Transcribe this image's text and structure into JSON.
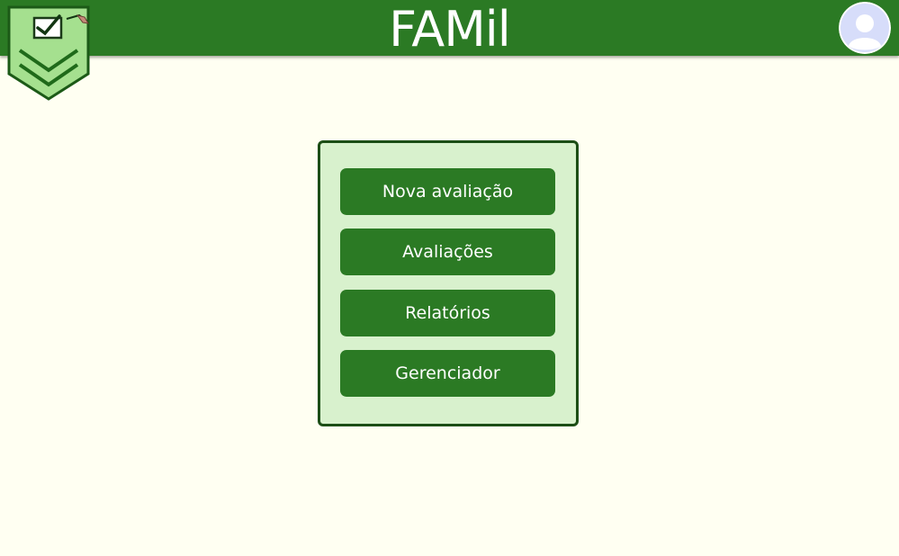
{
  "header": {
    "title": "FAMil",
    "logo_icon": "checklist-shield-logo-icon",
    "avatar_icon": "user-avatar-icon"
  },
  "menu": {
    "items": [
      {
        "label": "Nova avaliação"
      },
      {
        "label": "Avaliações"
      },
      {
        "label": "Relatórios"
      },
      {
        "label": "Gerenciador"
      }
    ]
  },
  "colors": {
    "header_bg": "#2b7a24",
    "page_bg": "#fffff2",
    "panel_bg": "#d8f1cd",
    "panel_border": "#1c4e16",
    "button_bg": "#2b7a24",
    "button_text": "#ffffff"
  }
}
